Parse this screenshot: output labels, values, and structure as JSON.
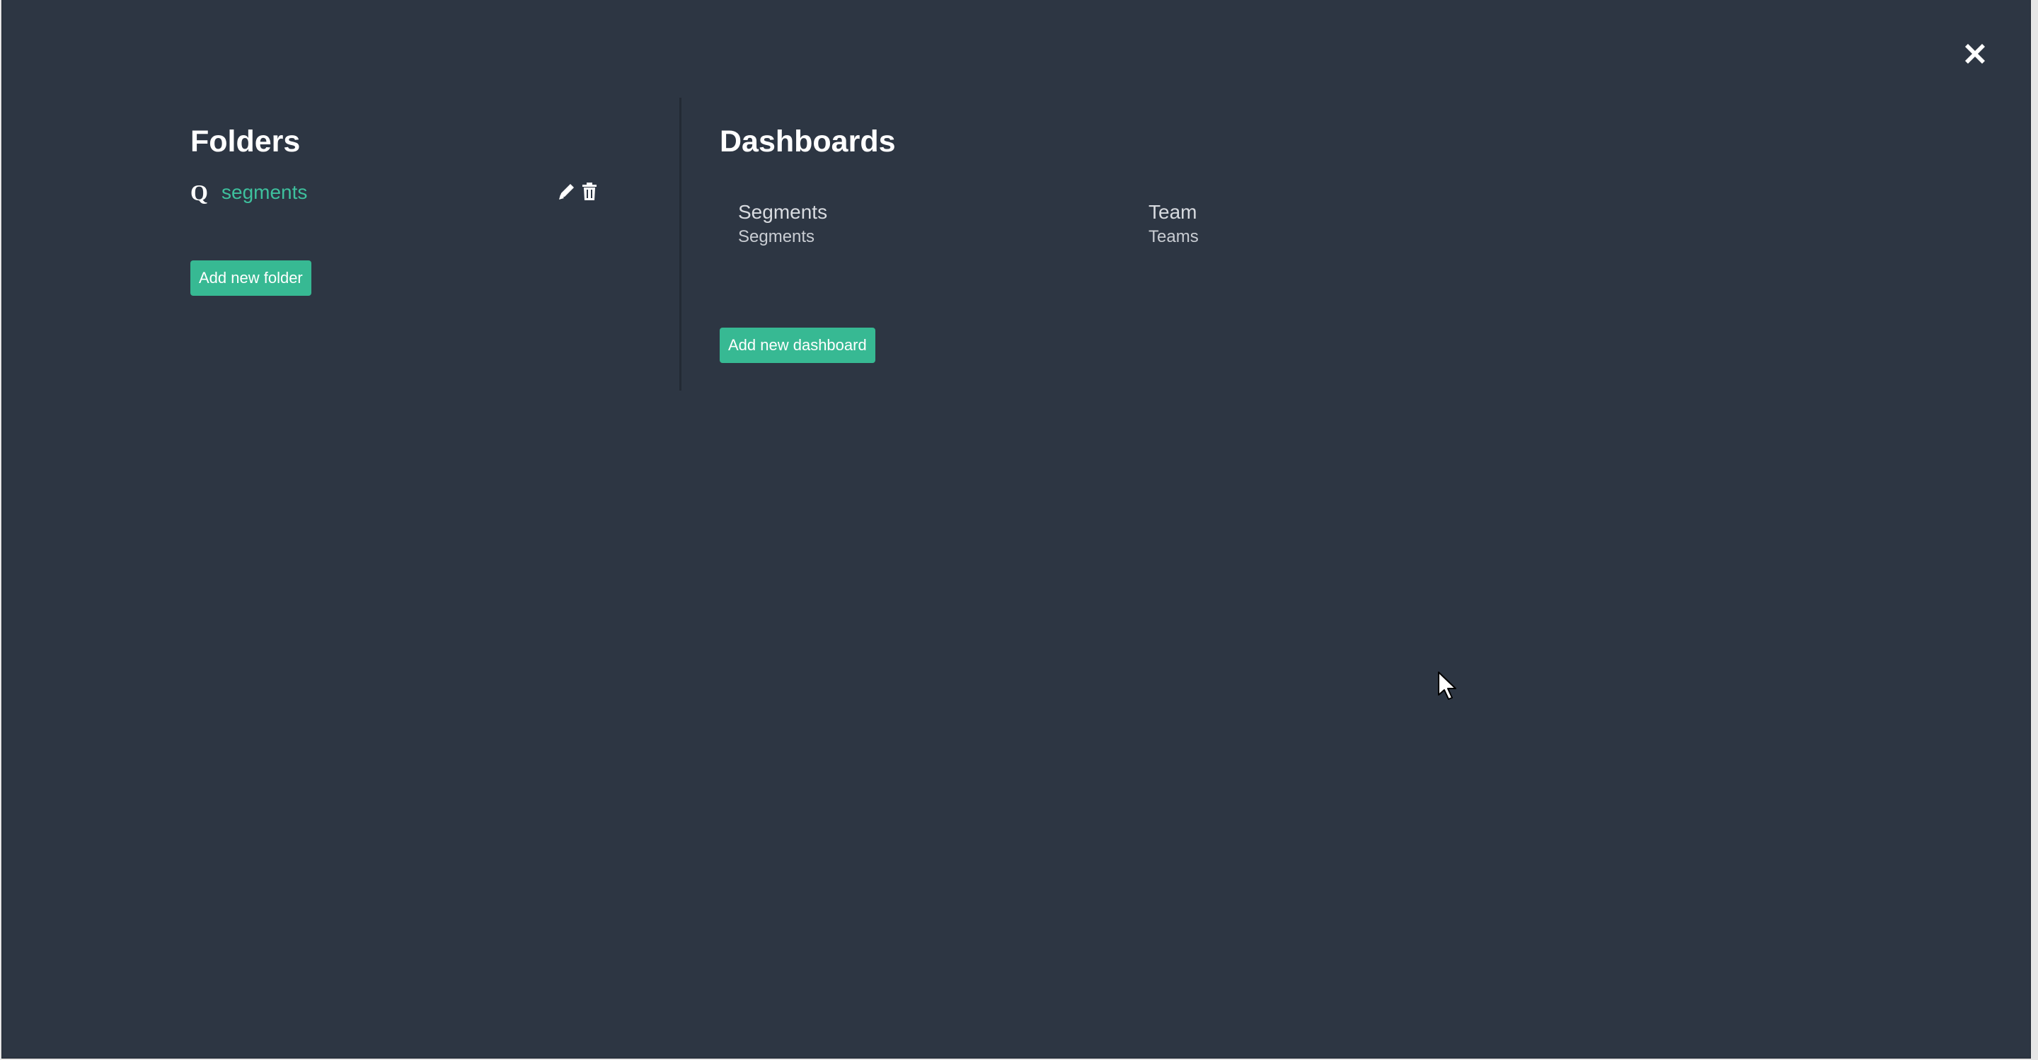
{
  "folders": {
    "title": "Folders",
    "items": [
      {
        "icon_letter": "Q",
        "name": "segments"
      }
    ],
    "add_label": "Add new folder"
  },
  "dashboards": {
    "title": "Dashboards",
    "items": [
      {
        "title": "Segments",
        "subtitle": "Segments"
      },
      {
        "title": "Team",
        "subtitle": "Teams"
      }
    ],
    "add_label": "Add new dashboard"
  },
  "icons": {
    "close": "close-icon",
    "edit": "pencil-icon",
    "delete": "trash-icon",
    "cursor": "mouse-pointer-icon"
  },
  "colors": {
    "background": "#2d3643",
    "accent": "#37b993",
    "link": "#3ec09d",
    "text": "#ffffff"
  }
}
